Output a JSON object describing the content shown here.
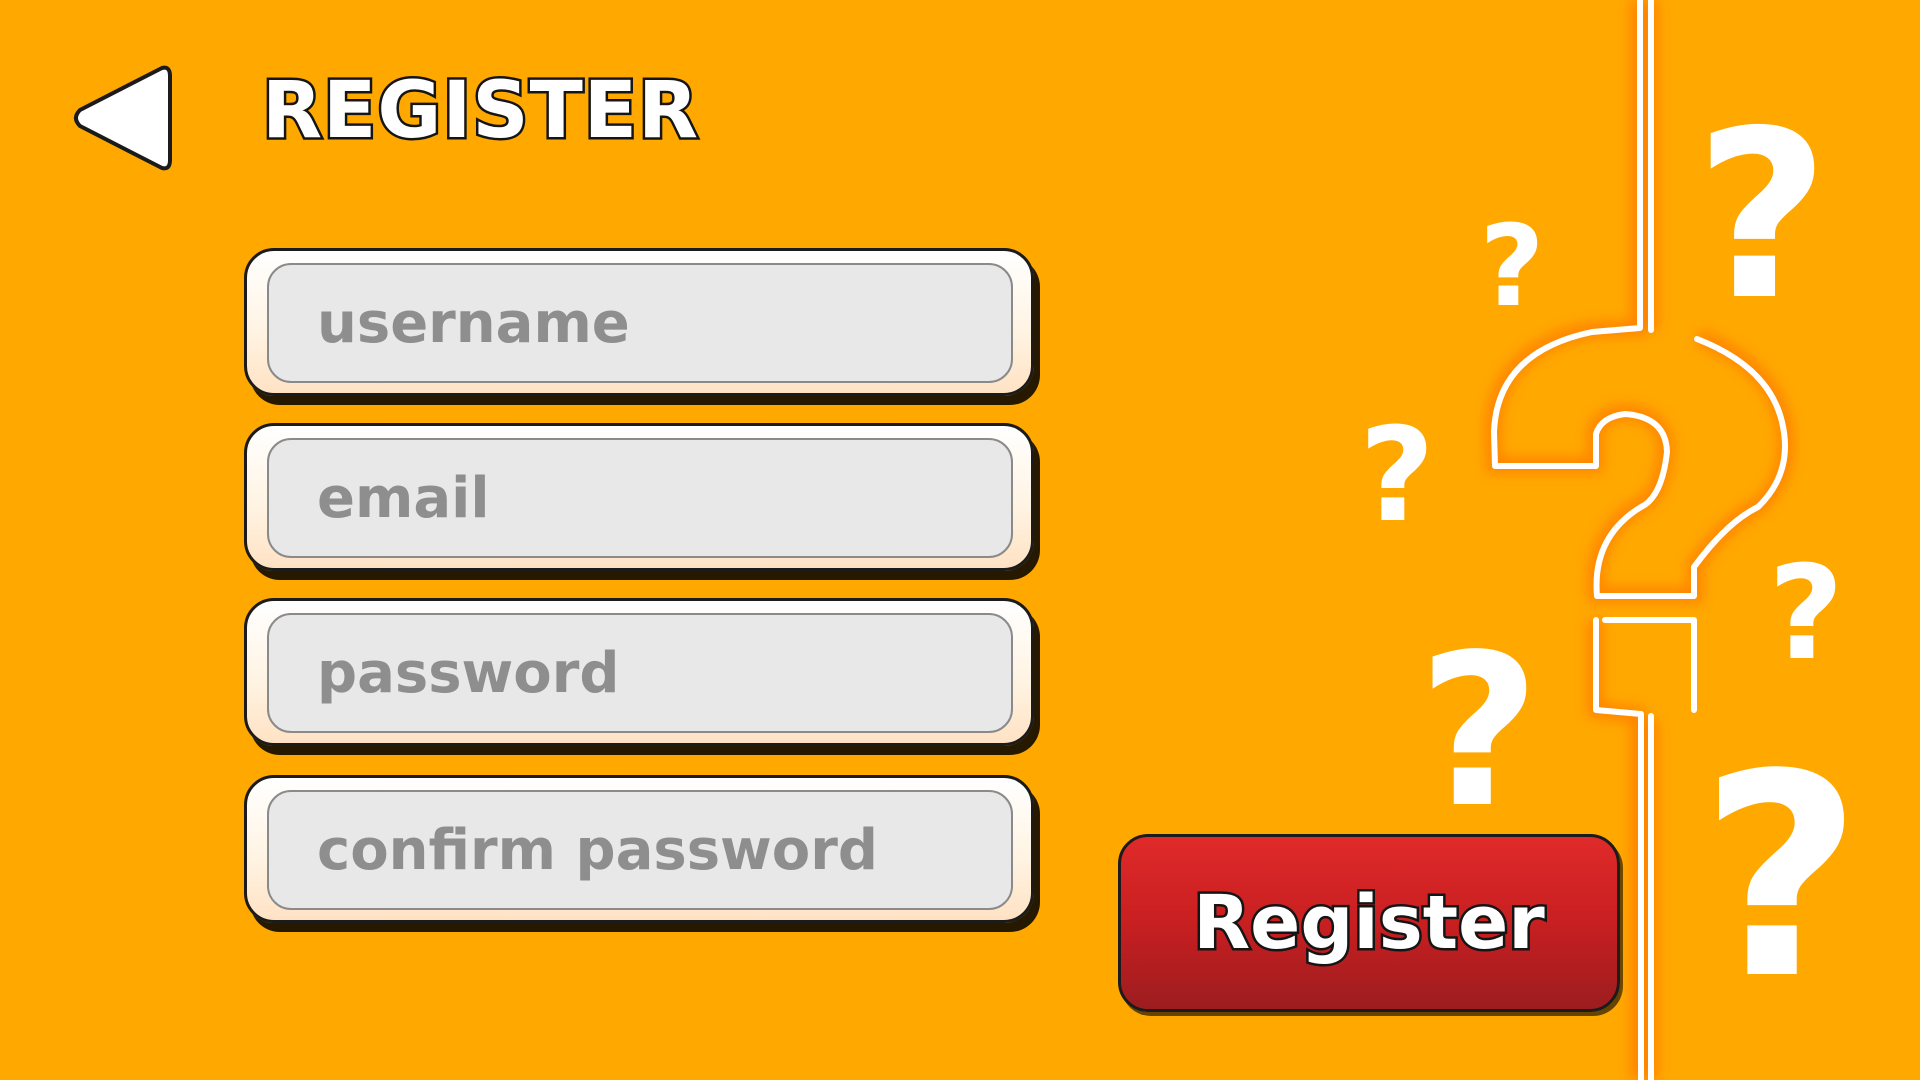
{
  "header": {
    "title": "REGISTER",
    "back_icon": "back-arrow-icon"
  },
  "form": {
    "fields": [
      {
        "name": "username",
        "placeholder": "username",
        "value": ""
      },
      {
        "name": "email",
        "placeholder": "email",
        "value": ""
      },
      {
        "name": "password",
        "placeholder": "password",
        "value": ""
      },
      {
        "name": "confirm_password",
        "placeholder": "confirm password",
        "value": ""
      }
    ],
    "submit_label": "Register"
  },
  "decoration": {
    "icon": "question-mark-icon",
    "color": "#FFFFFF"
  },
  "colors": {
    "background": "#FFA800",
    "button": "#C81F21",
    "field_fill": "#E8E8E8",
    "placeholder": "#8E8E8E"
  }
}
